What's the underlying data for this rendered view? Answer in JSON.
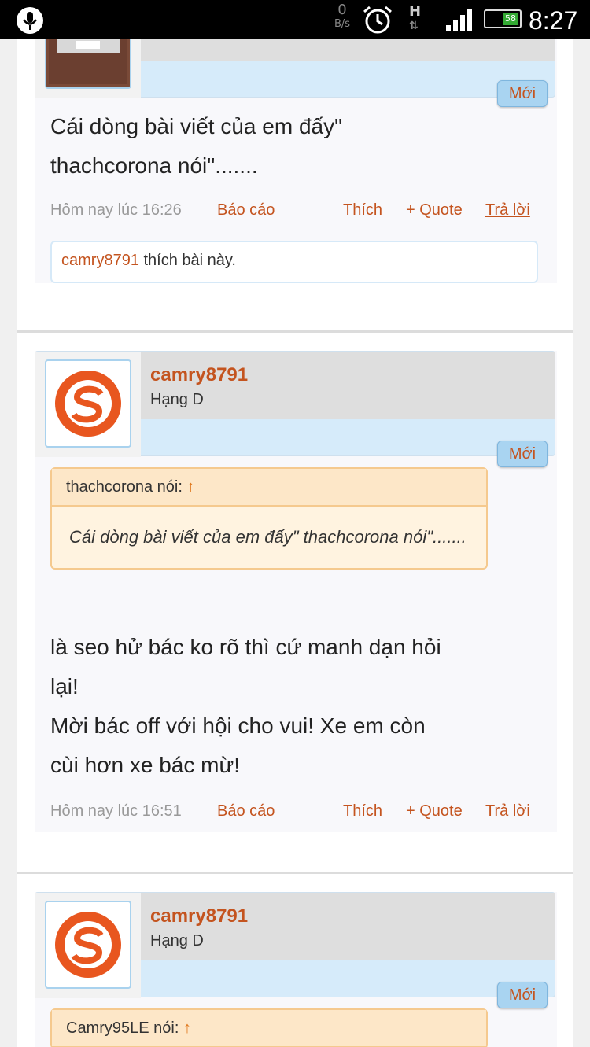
{
  "status_bar": {
    "net_rate": "0",
    "net_unit": "B/s",
    "signal_type": "H",
    "battery": "58",
    "time": "8:27",
    "icons": [
      "mic-icon",
      "alarm-icon",
      "signal-bars-icon",
      "battery-icon"
    ]
  },
  "posts": [
    {
      "new_label": "Mới",
      "body": [
        "Cái dòng bài viết của em đấy\"",
        "thachcorona nói\"......."
      ],
      "date": "Hôm nay lúc 16:26",
      "report": "Báo cáo",
      "like": "Thích",
      "quote": "+ Quote",
      "reply": "Trả lời",
      "likes_user": "camry8791",
      "likes_text": " thích bài này."
    },
    {
      "username": "camry8791",
      "rank": "Hạng D",
      "new_label": "Mới",
      "quote_author": "thachcorona nói:",
      "quote_arrow": "↑",
      "quote_text": "Cái dòng bài viết của em đấy\" thachcorona nói\".......",
      "body": [
        "là seo hử bác ko rõ thì cứ manh dạn hỏi",
        "lại!",
        "Mời bác off với hội cho vui! Xe em còn",
        "cùi hơn xe bác mừ!"
      ],
      "date": "Hôm nay lúc 16:51",
      "report": "Báo cáo",
      "like": "Thích",
      "quote": "+ Quote",
      "reply": "Trả lời"
    },
    {
      "username": "camry8791",
      "rank": "Hạng D",
      "new_label": "Mới",
      "quote_author": "Camry95LE nói:",
      "quote_arrow": "↑"
    }
  ],
  "colors": {
    "accent": "#c4541f",
    "userbox": "#d6ebfa",
    "quote_border": "#f5c98e"
  }
}
